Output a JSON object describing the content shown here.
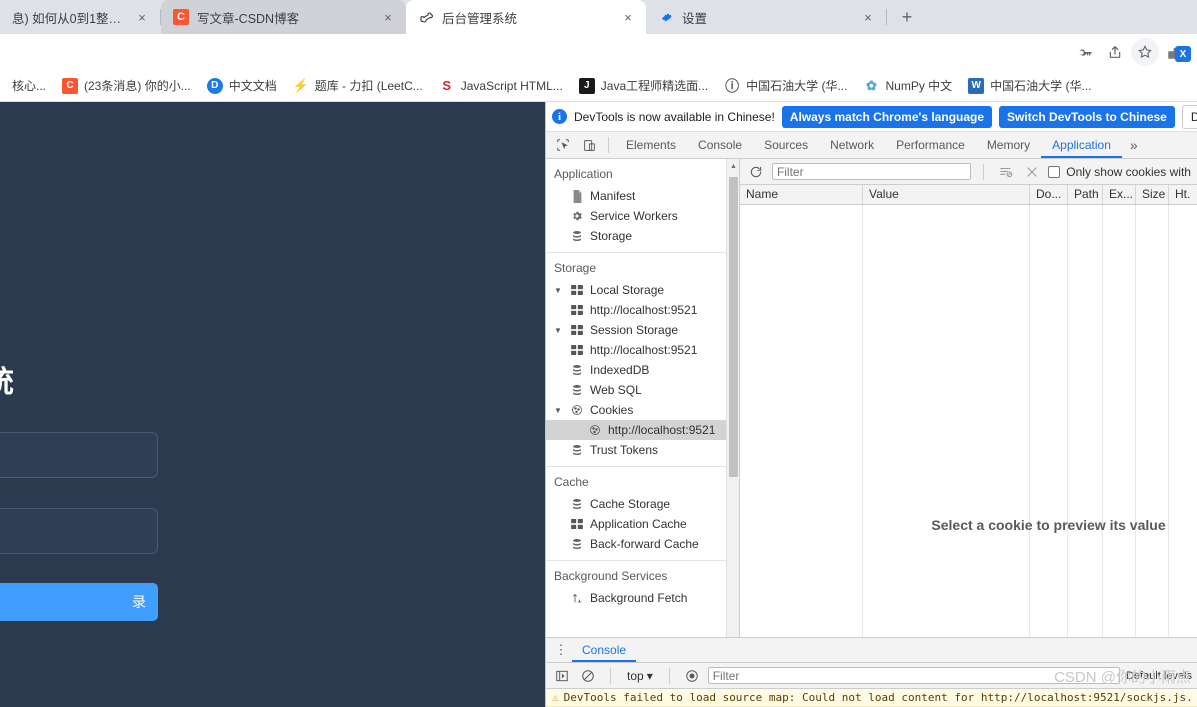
{
  "browser": {
    "tabs": [
      {
        "favicon": "none-icon",
        "title": "息) 如何从0到1整合出一",
        "state": "inactive-clipped"
      },
      {
        "favicon": "csdn-icon",
        "title": "写文章-CSDN博客",
        "state": "inactive"
      },
      {
        "favicon": "bone-icon",
        "title": "后台管理系统",
        "state": "active"
      },
      {
        "favicon": "gear-icon",
        "title": "设置",
        "state": "inactive"
      }
    ],
    "new_tab_label": "+",
    "close_label": "×",
    "toolbar_icons": [
      "key-icon",
      "share-icon",
      "star-icon",
      "extension-icon"
    ],
    "extension_badge": "X",
    "bookmarks": [
      {
        "icon": "none",
        "label": "核心...",
        "color": "#ffffff"
      },
      {
        "icon": "C",
        "label": "(23条消息) 你的小...",
        "color": "#fc5531"
      },
      {
        "icon": "D",
        "label": "中文文档",
        "color": "#1a7ae8"
      },
      {
        "icon": "⚡",
        "label": "题库 - 力扣 (LeetC...",
        "color": "#ffa116"
      },
      {
        "icon": "S",
        "label": "JavaScript HTML...",
        "color": "#d9232e"
      },
      {
        "icon": "J",
        "label": "Java工程师精选面...",
        "color": "#1a1a1a"
      },
      {
        "icon": "ⓘ",
        "label": "中国石油大学 (华...",
        "color": "#5a5a5a"
      },
      {
        "icon": "✿",
        "label": "NumPy 中文",
        "color": "#4dabcf"
      },
      {
        "icon": "W",
        "label": "中国石油大学 (华...",
        "color": "#2b6cb8"
      }
    ]
  },
  "webpage": {
    "title": "端系统",
    "login_button_label": "录",
    "bg_color": "#2b3a4f",
    "accent_color": "#409eff"
  },
  "devtools": {
    "banner": {
      "message": "DevTools is now available in Chinese!",
      "primary_button": "Always match Chrome's language",
      "secondary_button": "Switch DevTools to Chinese",
      "dismiss_button": "Don't show"
    },
    "panel_tabs": [
      {
        "label": "Elements",
        "selected": false
      },
      {
        "label": "Console",
        "selected": false
      },
      {
        "label": "Sources",
        "selected": false
      },
      {
        "label": "Network",
        "selected": false
      },
      {
        "label": "Performance",
        "selected": false
      },
      {
        "label": "Memory",
        "selected": false
      },
      {
        "label": "Application",
        "selected": true
      }
    ],
    "more_tabs_label": "»",
    "sidebar": {
      "sections": [
        {
          "header": "Application",
          "items": [
            {
              "label": "Manifest",
              "icon": "manifest-icon",
              "indent": 1,
              "arrow": "",
              "selected": false
            },
            {
              "label": "Service Workers",
              "icon": "gear-icon",
              "indent": 1,
              "arrow": "",
              "selected": false
            },
            {
              "label": "Storage",
              "icon": "database-icon",
              "indent": 1,
              "arrow": "",
              "selected": false
            }
          ]
        },
        {
          "header": "Storage",
          "items": [
            {
              "label": "Local Storage",
              "icon": "table-icon",
              "indent": 0,
              "arrow": "▼",
              "selected": false
            },
            {
              "label": "http://localhost:9521",
              "icon": "table-icon",
              "indent": 1,
              "arrow": "",
              "selected": false
            },
            {
              "label": "Session Storage",
              "icon": "table-icon",
              "indent": 0,
              "arrow": "▼",
              "selected": false
            },
            {
              "label": "http://localhost:9521",
              "icon": "table-icon",
              "indent": 1,
              "arrow": "",
              "selected": false
            },
            {
              "label": "IndexedDB",
              "icon": "database-icon",
              "indent": 1,
              "arrow": "",
              "selected": false
            },
            {
              "label": "Web SQL",
              "icon": "database-icon",
              "indent": 1,
              "arrow": "",
              "selected": false
            },
            {
              "label": "Cookies",
              "icon": "cookie-icon",
              "indent": 0,
              "arrow": "▼",
              "selected": false
            },
            {
              "label": "http://localhost:9521",
              "icon": "cookie-icon",
              "indent": 2,
              "arrow": "",
              "selected": true
            },
            {
              "label": "Trust Tokens",
              "icon": "database-icon",
              "indent": 1,
              "arrow": "",
              "selected": false
            }
          ]
        },
        {
          "header": "Cache",
          "items": [
            {
              "label": "Cache Storage",
              "icon": "database-icon",
              "indent": 1,
              "arrow": "",
              "selected": false
            },
            {
              "label": "Application Cache",
              "icon": "table-icon",
              "indent": 1,
              "arrow": "",
              "selected": false
            },
            {
              "label": "Back-forward Cache",
              "icon": "database-icon",
              "indent": 1,
              "arrow": "",
              "selected": false
            }
          ]
        },
        {
          "header": "Background Services",
          "items": [
            {
              "label": "Background Fetch",
              "icon": "fetch-icon",
              "indent": 1,
              "arrow": "",
              "selected": false
            }
          ]
        }
      ]
    },
    "cookies_toolbar": {
      "refresh_icon": "refresh-icon",
      "filter_placeholder": "Filter",
      "clear_filtered_icon": "clear-filtered-icon",
      "clear_all_icon": "clear-all-icon",
      "checkbox_label": "Only show cookies with",
      "checkbox_checked": false
    },
    "cookies_table": {
      "columns": [
        "Name",
        "Value",
        "Do...",
        "Path",
        "Ex...",
        "Size",
        "Ht."
      ],
      "rows": []
    },
    "preview_message": "Select a cookie to preview its value",
    "drawer": {
      "kebab_icon": "kebab-menu-icon",
      "tabs": [
        {
          "label": "Console",
          "selected": true
        }
      ],
      "toolbar": {
        "sidebar_toggle_icon": "show-console-sidebar-icon",
        "clear_icon": "clear-console-icon",
        "context_label": "top",
        "context_caret": "▾",
        "eye_icon": "live-expression-icon",
        "filter_placeholder": "Filter",
        "level_label": "Default levels"
      },
      "messages": [
        {
          "level": "warning",
          "icon": "warning-icon",
          "text": "DevTools failed to load source map: Could not load content for http://localhost:9521/sockjs.js."
        }
      ]
    }
  },
  "watermark": "CSDN @你的小雨点"
}
